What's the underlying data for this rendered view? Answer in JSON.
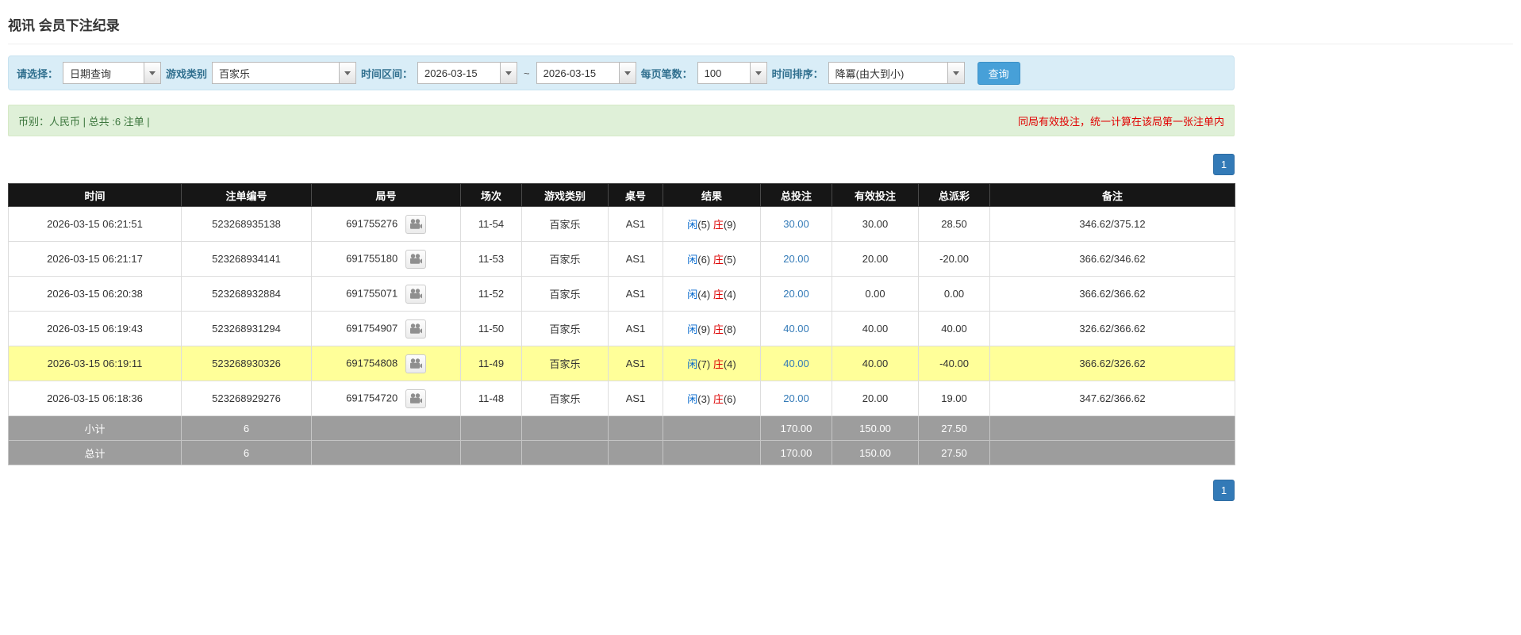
{
  "page": {
    "title": "视讯 会员下注纪录"
  },
  "filters": {
    "select_label": "请选择：",
    "select_value": "日期查询",
    "game_type_label": "游戏类别",
    "game_type_value": "百家乐",
    "time_range_label": "时间区间：",
    "date_from": "2026-03-15",
    "tilde": "~",
    "date_to": "2026-03-15",
    "page_size_label": "每页笔数：",
    "page_size_value": "100",
    "sort_label": "时间排序：",
    "sort_value": "降冪(由大到小)",
    "search_button": "查询"
  },
  "summary": {
    "left": "币别：人民币 | 总共 :6 注单 |",
    "right": "同局有效投注，统一计算在该局第一张注单内"
  },
  "pagination": {
    "page": "1"
  },
  "table": {
    "headers": [
      "时间",
      "注单编号",
      "局号",
      "场次",
      "游戏类别",
      "桌号",
      "结果",
      "总投注",
      "有效投注",
      "总派彩",
      "备注"
    ],
    "rows": [
      {
        "time": "2026-03-15 06:21:51",
        "bet_id": "523268935138",
        "round_id": "691755276",
        "session": "11-54",
        "game": "百家乐",
        "table_no": "AS1",
        "result": {
          "player_label": "闲",
          "player_value": "(5)",
          "banker_label": "庄",
          "banker_value": "(9)"
        },
        "total_bet": "30.00",
        "valid_bet": "30.00",
        "payout": "28.50",
        "remark": "346.62/375.12",
        "highlight": false
      },
      {
        "time": "2026-03-15 06:21:17",
        "bet_id": "523268934141",
        "round_id": "691755180",
        "session": "11-53",
        "game": "百家乐",
        "table_no": "AS1",
        "result": {
          "player_label": "闲",
          "player_value": "(6)",
          "banker_label": "庄",
          "banker_value": "(5)"
        },
        "total_bet": "20.00",
        "valid_bet": "20.00",
        "payout": "-20.00",
        "remark": "366.62/346.62",
        "highlight": false
      },
      {
        "time": "2026-03-15 06:20:38",
        "bet_id": "523268932884",
        "round_id": "691755071",
        "session": "11-52",
        "game": "百家乐",
        "table_no": "AS1",
        "result": {
          "player_label": "闲",
          "player_value": "(4)",
          "banker_label": "庄",
          "banker_value": "(4)"
        },
        "total_bet": "20.00",
        "valid_bet": "0.00",
        "payout": "0.00",
        "remark": "366.62/366.62",
        "highlight": false
      },
      {
        "time": "2026-03-15 06:19:43",
        "bet_id": "523268931294",
        "round_id": "691754907",
        "session": "11-50",
        "game": "百家乐",
        "table_no": "AS1",
        "result": {
          "player_label": "闲",
          "player_value": "(9)",
          "banker_label": "庄",
          "banker_value": "(8)"
        },
        "total_bet": "40.00",
        "valid_bet": "40.00",
        "payout": "40.00",
        "remark": "326.62/366.62",
        "highlight": false
      },
      {
        "time": "2026-03-15 06:19:11",
        "bet_id": "523268930326",
        "round_id": "691754808",
        "session": "11-49",
        "game": "百家乐",
        "table_no": "AS1",
        "result": {
          "player_label": "闲",
          "player_value": "(7)",
          "banker_label": "庄",
          "banker_value": "(4)"
        },
        "total_bet": "40.00",
        "valid_bet": "40.00",
        "payout": "-40.00",
        "remark": "366.62/326.62",
        "highlight": true
      },
      {
        "time": "2026-03-15 06:18:36",
        "bet_id": "523268929276",
        "round_id": "691754720",
        "session": "11-48",
        "game": "百家乐",
        "table_no": "AS1",
        "result": {
          "player_label": "闲",
          "player_value": "(3)",
          "banker_label": "庄",
          "banker_value": "(6)"
        },
        "total_bet": "20.00",
        "valid_bet": "20.00",
        "payout": "19.00",
        "remark": "347.62/366.62",
        "highlight": false
      }
    ],
    "footer": [
      {
        "label": "小计",
        "count": "6",
        "empty": "",
        "total_bet": "170.00",
        "valid_bet": "150.00",
        "payout": "27.50",
        "remark": ""
      },
      {
        "label": "总计",
        "count": "6",
        "empty": "",
        "total_bet": "170.00",
        "valid_bet": "150.00",
        "payout": "27.50",
        "remark": ""
      }
    ]
  },
  "icons": {
    "dropdown_caret": "caret-down",
    "round_video": "video-camera"
  },
  "colors": {
    "accent_blue": "#337ab7",
    "search_button_blue": "#47a0d8",
    "player_blue": "#0066cc",
    "banker_red": "#dd0000",
    "negative_red": "#dd0000",
    "highlight_yellow": "#ffff99",
    "filter_bar_bg": "#d9edf7",
    "filter_label_blue": "#31708f",
    "summary_bar_bg": "#dff0d8",
    "summary_text_green": "#3c763d",
    "notice_red": "#e00000",
    "table_header_bg": "#161616",
    "footer_row_bg": "#9d9d9d"
  }
}
